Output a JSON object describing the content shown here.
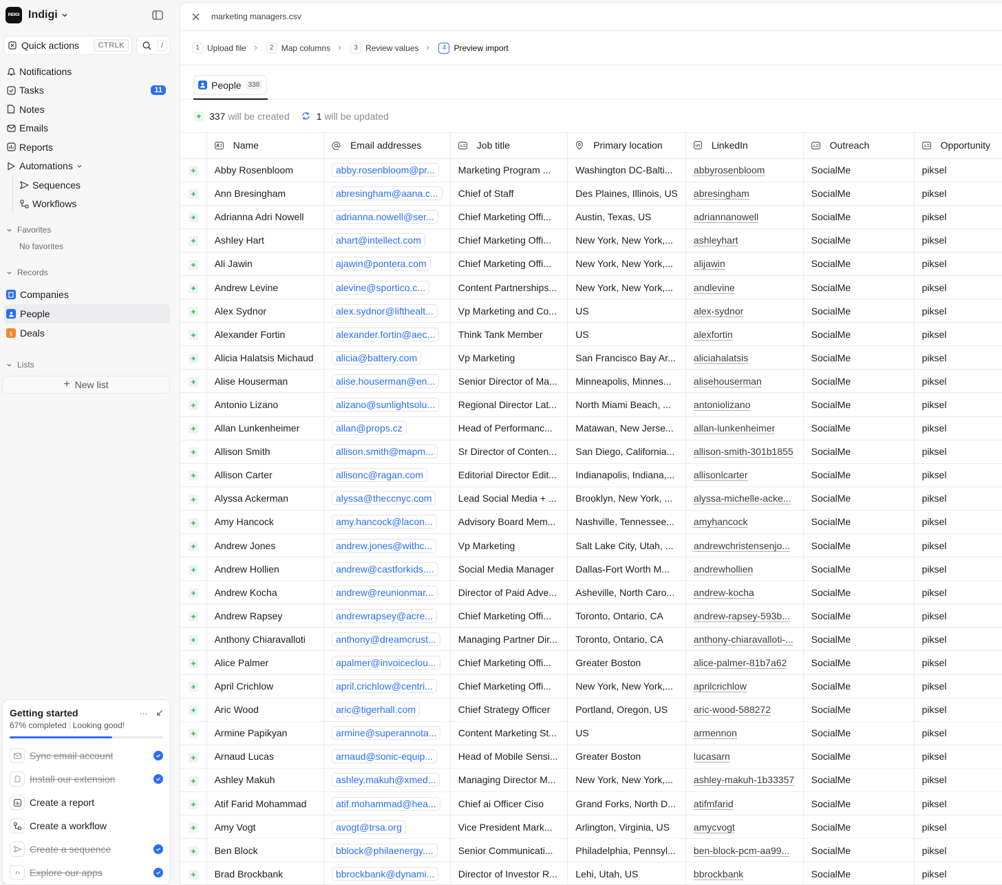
{
  "workspace": {
    "logo_text": "INDIGI",
    "name": "Indigi"
  },
  "quick_actions": {
    "label": "Quick actions",
    "shortcut": "CTRLK",
    "search_shortcut": "/"
  },
  "nav": {
    "notifications": "Notifications",
    "tasks": "Tasks",
    "tasks_badge": "11",
    "notes": "Notes",
    "emails": "Emails",
    "reports": "Reports",
    "automations": "Automations",
    "sequences": "Sequences",
    "workflows": "Workflows"
  },
  "favorites": {
    "title": "Favorites",
    "empty": "No favorites"
  },
  "records": {
    "title": "Records",
    "items": [
      "Companies",
      "People",
      "Deals"
    ]
  },
  "lists": {
    "title": "Lists",
    "new_list": "New list"
  },
  "getting_started": {
    "title": "Getting started",
    "progress_text": "67% completed",
    "status": "Looking good!",
    "progress": 0.67,
    "items": [
      {
        "label": "Sync email account",
        "done": true
      },
      {
        "label": "Install our extension",
        "done": true
      },
      {
        "label": "Create a report",
        "done": false
      },
      {
        "label": "Create a workflow",
        "done": false
      },
      {
        "label": "Create a sequence",
        "done": true
      },
      {
        "label": "Explore our apps",
        "done": true
      }
    ]
  },
  "import": {
    "file_name": "marketing managers.csv",
    "steps": [
      {
        "num": "1",
        "label": "Upload file"
      },
      {
        "num": "2",
        "label": "Map columns"
      },
      {
        "num": "3",
        "label": "Review values"
      },
      {
        "num": "4",
        "label": "Preview import"
      }
    ],
    "tab": {
      "label": "People",
      "count": "338"
    },
    "summary": {
      "created_count": "337",
      "created_text": "will be created",
      "updated_count": "1",
      "updated_text": "will be updated"
    }
  },
  "table": {
    "columns": [
      "Name",
      "Email addresses",
      "Job title",
      "Primary location",
      "LinkedIn",
      "Outreach",
      "Opportunity"
    ],
    "rows": [
      [
        "Abby Rosenbloom",
        "abby.rosenbloom@pr...",
        "Marketing Program ...",
        "Washington DC-Balti...",
        "abbyrosenbloom",
        "SocialMe",
        "piksel"
      ],
      [
        "Ann Bresingham",
        "abresingham@aana.c...",
        "Chief of Staff",
        "Des Plaines, Illinois, US",
        "abresingham",
        "SocialMe",
        "piksel"
      ],
      [
        "Adrianna Adri Nowell",
        "adrianna.nowell@ser...",
        "Chief Marketing Offi...",
        "Austin, Texas, US",
        "adriannanowell",
        "SocialMe",
        "piksel"
      ],
      [
        "Ashley Hart",
        "ahart@intellect.com",
        "Chief Marketing Offi...",
        "New York, New York,...",
        "ashleyhart",
        "SocialMe",
        "piksel"
      ],
      [
        "Ali Jawin",
        "ajawin@pontera.com",
        "Chief Marketing Offi...",
        "New York, New York,...",
        "alijawin",
        "SocialMe",
        "piksel"
      ],
      [
        "Andrew Levine",
        "alevine@sportico.c...",
        "Content Partnerships...",
        "New York, New York,...",
        "andlevine",
        "SocialMe",
        "piksel"
      ],
      [
        "Alex Sydnor",
        "alex.sydnor@lifthealt...",
        "Vp Marketing and Co...",
        "US",
        "alex-sydnor",
        "SocialMe",
        "piksel"
      ],
      [
        "Alexander Fortin",
        "alexander.fortin@aec...",
        "Think Tank Member",
        "US",
        "alexfortin",
        "SocialMe",
        "piksel"
      ],
      [
        "Alicia Halatsis Michaud",
        "alicia@battery.com",
        "Vp Marketing",
        "San Francisco Bay Ar...",
        "aliciahalatsis",
        "SocialMe",
        "piksel"
      ],
      [
        "Alise Houserman",
        "alise.houserman@en...",
        "Senior Director of Ma...",
        "Minneapolis, Minnes...",
        "alisehouserman",
        "SocialMe",
        "piksel"
      ],
      [
        "Antonio Lizano",
        "alizano@sunlightsolu...",
        "Regional Director Lat...",
        "North Miami Beach, ...",
        "antoniolizano",
        "SocialMe",
        "piksel"
      ],
      [
        "Allan Lunkenheimer",
        "allan@props.cz",
        "Head of Performanc...",
        "Matawan, New Jerse...",
        "allan-lunkenheimer",
        "SocialMe",
        "piksel"
      ],
      [
        "Allison Smith",
        "allison.smith@mapm...",
        "Sr Director of Conten...",
        "San Diego, California...",
        "allison-smith-301b1855",
        "SocialMe",
        "piksel"
      ],
      [
        "Allison Carter",
        "allisonc@ragan.com",
        "Editorial Director Edit...",
        "Indianapolis, Indiana,...",
        "allisonlcarter",
        "SocialMe",
        "piksel"
      ],
      [
        "Alyssa Ackerman",
        "alyssa@theccnyc.com",
        "Lead Social Media + ...",
        "Brooklyn, New York, ...",
        "alyssa-michelle-acke...",
        "SocialMe",
        "piksel"
      ],
      [
        "Amy Hancock",
        "amy.hancock@lacon...",
        "Advisory Board Mem...",
        "Nashville, Tennessee...",
        "amyhancock",
        "SocialMe",
        "piksel"
      ],
      [
        "Andrew Jones",
        "andrew.jones@withc...",
        "Vp Marketing",
        "Salt Lake City, Utah, ...",
        "andrewchristensenjo...",
        "SocialMe",
        "piksel"
      ],
      [
        "Andrew Hollien",
        "andrew@castforkids....",
        "Social Media Manager",
        "Dallas-Fort Worth M...",
        "andrewhollien",
        "SocialMe",
        "piksel"
      ],
      [
        "Andrew Kocha",
        "andrew@reunionmar...",
        "Director of Paid Adve...",
        "Asheville, North Caro...",
        "andrew-kocha",
        "SocialMe",
        "piksel"
      ],
      [
        "Andrew Rapsey",
        "andrewrapsey@acre...",
        "Chief Marketing Offi...",
        "Toronto, Ontario, CA",
        "andrew-rapsey-593b...",
        "SocialMe",
        "piksel"
      ],
      [
        "Anthony Chiaravalloti",
        "anthony@dreamcrust...",
        "Managing Partner Dir...",
        "Toronto, Ontario, CA",
        "anthony-chiaravalloti-...",
        "SocialMe",
        "piksel"
      ],
      [
        "Alice Palmer",
        "apalmer@invoiceclou...",
        "Chief Marketing Offi...",
        "Greater Boston",
        "alice-palmer-81b7a62",
        "SocialMe",
        "piksel"
      ],
      [
        "April Crichlow",
        "april.crichlow@centri...",
        "Chief Marketing Offi...",
        "New York, New York,...",
        "aprilcrichlow",
        "SocialMe",
        "piksel"
      ],
      [
        "Aric Wood",
        "aric@tigerhall.com",
        "Chief Strategy Officer",
        "Portland, Oregon, US",
        "aric-wood-588272",
        "SocialMe",
        "piksel"
      ],
      [
        "Armine Papikyan",
        "armine@superannota...",
        "Content Marketing St...",
        "US",
        "armennon",
        "SocialMe",
        "piksel"
      ],
      [
        "Arnaud Lucas",
        "arnaud@sonic-equip...",
        "Head of Mobile Sensi...",
        "Greater Boston",
        "lucasarn",
        "SocialMe",
        "piksel"
      ],
      [
        "Ashley Makuh",
        "ashley.makuh@xmed...",
        "Managing Director M...",
        "New York, New York,...",
        "ashley-makuh-1b33357",
        "SocialMe",
        "piksel"
      ],
      [
        "Atif Farid Mohammad",
        "atif.mohammad@hea...",
        "Chief ai Officer Ciso",
        "Grand Forks, North D...",
        "atifmfarid",
        "SocialMe",
        "piksel"
      ],
      [
        "Amy Vogt",
        "avogt@trsa.org",
        "Vice President Mark...",
        "Arlington, Virginia, US",
        "amycvogt",
        "SocialMe",
        "piksel"
      ],
      [
        "Ben Block",
        "bblock@philaenergy....",
        "Senior Communicati...",
        "Philadelphia, Pennsyl...",
        "ben-block-pcm-aa99...",
        "SocialMe",
        "piksel"
      ],
      [
        "Brad Brockbank",
        "bbrockbank@dynami...",
        "Director of Investor R...",
        "Lehi, Utah, US",
        "bbrockbank",
        "SocialMe",
        "piksel"
      ]
    ]
  }
}
